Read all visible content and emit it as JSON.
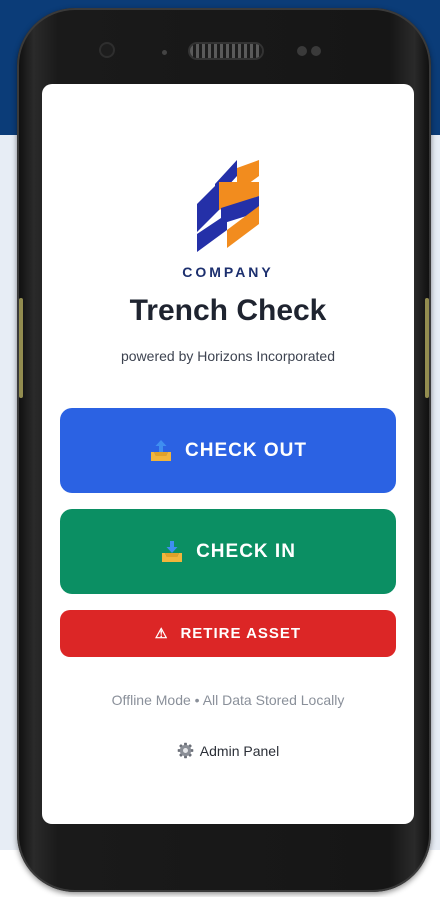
{
  "app": {
    "logo_text": "COMPANY",
    "title": "Trench Check",
    "subtitle": "powered by Horizons Incorporated"
  },
  "actions": {
    "check_out": {
      "label": "CHECK OUT",
      "icon": "outbox-tray-icon",
      "color": "#2b62e3"
    },
    "check_in": {
      "label": "CHECK IN",
      "icon": "inbox-tray-icon",
      "color": "#0b8f63"
    },
    "retire": {
      "label": "RETIRE ASSET",
      "icon": "warning-icon",
      "warning_glyph": "⚠",
      "color": "#dc2626"
    }
  },
  "footer": {
    "status": "Offline Mode • All Data Stored Locally",
    "admin_label": "Admin Panel",
    "admin_icon": "gear-icon"
  },
  "colors": {
    "brand_navy": "#1c2f6e",
    "logo_orange": "#f28c1e",
    "background_top": "#0b3c78"
  }
}
